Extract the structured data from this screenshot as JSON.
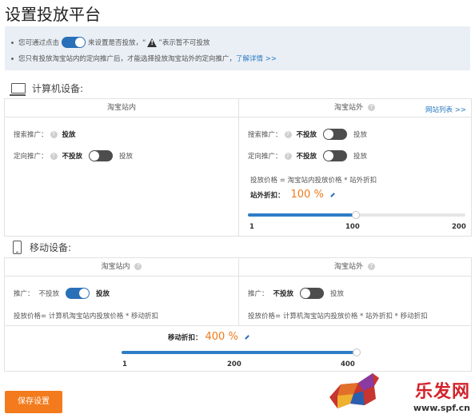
{
  "page": {
    "title": "设置投放平台"
  },
  "notice": {
    "line1_a": "您可通过点击",
    "line1_b": "来设置是否投放，“",
    "line1_c": "”表示暂不可投放",
    "line2_a": "您只有投放淘宝站内的定向推广后，才能选择投放淘宝站外的定向推广，",
    "line2_link": "了解详情 >>"
  },
  "pc": {
    "section_label": "计算机设备:",
    "inner": {
      "header": "淘宝站内",
      "search_label": "搜索推广：",
      "search_value": "投放",
      "target_label": "定向推广：",
      "target_off": "不投放",
      "target_on": "投放",
      "target_state": "off"
    },
    "outer": {
      "header": "淘宝站外",
      "site_list_link": "网站列表 >>",
      "search_label": "搜索推广：",
      "search_off": "不投放",
      "search_on": "投放",
      "search_state": "off",
      "target_label": "定向推广：",
      "target_off": "不投放",
      "target_on": "投放",
      "target_state": "off",
      "price_formula": "投放价格 = 淘宝站内投放价格 * 站外折扣",
      "discount_label": "站外折扣：",
      "discount_value": "100 %",
      "slider": {
        "min": 1,
        "max": 200,
        "value": 100,
        "tick_labels": [
          "1",
          "100",
          "200"
        ]
      }
    }
  },
  "mobile": {
    "section_label": "移动设备:",
    "inner": {
      "header": "淘宝站内",
      "promo_label": "推广：",
      "promo_off": "不投放",
      "promo_on": "投放",
      "promo_state": "on",
      "price_formula": "投放价格= 计算机淘宝站内投放价格 * 移动折扣"
    },
    "outer": {
      "header": "淘宝站外",
      "promo_label": "推广：",
      "promo_off": "不投放",
      "promo_on": "投放",
      "promo_state": "off",
      "price_formula": "投放价格= 计算机淘宝站内投放价格 * 站外折扣 * 移动折扣"
    },
    "discount_label": "移动折扣：",
    "discount_value": "400 %",
    "slider": {
      "min": 1,
      "max": 400,
      "value": 400,
      "tick_labels": [
        "1",
        "200",
        "400"
      ]
    }
  },
  "save_button": "保存设置",
  "watermark": {
    "text": "乐发网",
    "url": "www.spf.cn"
  },
  "colors": {
    "accent": "#2a70b8",
    "orange": "#f37b1d",
    "notice_bg": "#e9eff5"
  }
}
